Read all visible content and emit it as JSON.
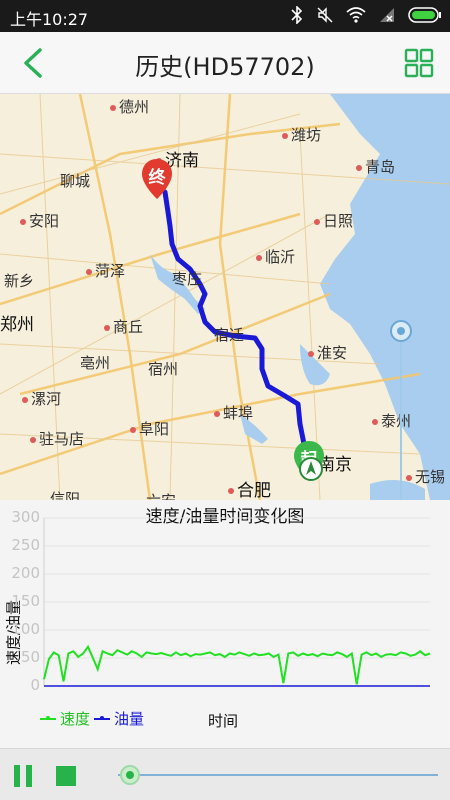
{
  "status_bar": {
    "time": "上午10:27"
  },
  "header": {
    "title": "历史(HD57702)"
  },
  "map": {
    "cities": [
      {
        "name": "德州",
        "big": false
      },
      {
        "name": "潍坊",
        "big": false
      },
      {
        "name": "济南",
        "big": true
      },
      {
        "name": "青岛",
        "big": false
      },
      {
        "name": "聊城",
        "big": false
      },
      {
        "name": "安阳",
        "big": false
      },
      {
        "name": "日照",
        "big": false
      },
      {
        "name": "新乡",
        "big": false
      },
      {
        "name": "菏泽",
        "big": false
      },
      {
        "name": "枣庄",
        "big": false
      },
      {
        "name": "临沂",
        "big": false
      },
      {
        "name": "郑州",
        "big": true
      },
      {
        "name": "商丘",
        "big": false
      },
      {
        "name": "宿迁",
        "big": false
      },
      {
        "name": "淮安",
        "big": false
      },
      {
        "name": "亳州",
        "big": false
      },
      {
        "name": "宿州",
        "big": false
      },
      {
        "name": "漯河",
        "big": false
      },
      {
        "name": "蚌埠",
        "big": false
      },
      {
        "name": "泰州",
        "big": false
      },
      {
        "name": "驻马店",
        "big": false
      },
      {
        "name": "阜阳",
        "big": false
      },
      {
        "name": "南京",
        "big": true
      },
      {
        "name": "合肥",
        "big": true
      },
      {
        "name": "无锡",
        "big": false
      },
      {
        "name": "信阳",
        "big": false
      },
      {
        "name": "六安",
        "big": false
      }
    ],
    "end_marker": "终",
    "start_marker": "起",
    "route_color": "#1a1ad6"
  },
  "chart_data": {
    "type": "line",
    "title": "速度/油量时间变化图",
    "ylabel": "速度/油量",
    "xlabel": "时间",
    "ylim": [
      0,
      300
    ],
    "yticks": [
      "300",
      "250",
      "200",
      "150",
      "100",
      "50",
      "0"
    ],
    "grid": true,
    "legend": "bottom-left",
    "series": [
      {
        "name": "速度",
        "color": "#22e022",
        "values": [
          12,
          48,
          60,
          55,
          8,
          58,
          62,
          52,
          58,
          70,
          50,
          30,
          62,
          58,
          55,
          64,
          60,
          56,
          62,
          58,
          52,
          60,
          58,
          57,
          59,
          56,
          54,
          60,
          55,
          58,
          53,
          57,
          56,
          58,
          60,
          55,
          57,
          52,
          58,
          56,
          60,
          57,
          54,
          58,
          55,
          56,
          58,
          52,
          56,
          5,
          58,
          60,
          54,
          58,
          55,
          57,
          53,
          58,
          56,
          55,
          60,
          57,
          52,
          58,
          3,
          56,
          60,
          55,
          58,
          52,
          56,
          57,
          55,
          60,
          58,
          54,
          56,
          62,
          55,
          58
        ]
      },
      {
        "name": "油量",
        "color": "#1a1ad6",
        "values": [
          0,
          0,
          0,
          0,
          0,
          0,
          0,
          0,
          0,
          0,
          0,
          0,
          0,
          0,
          0,
          0,
          0,
          0,
          0,
          0,
          0,
          0,
          0,
          0,
          0,
          0,
          0,
          0,
          0,
          0,
          0,
          0,
          0,
          0,
          0,
          0,
          0,
          0,
          0,
          0,
          0,
          0,
          0,
          0,
          0,
          0,
          0,
          0,
          0,
          0,
          0,
          0,
          0,
          0,
          0,
          0,
          0,
          0,
          0,
          0,
          0,
          0,
          0,
          0,
          0,
          0,
          0,
          0,
          0,
          0,
          0,
          0,
          0,
          0,
          0,
          0,
          0,
          0,
          0,
          0
        ]
      }
    ]
  },
  "colors": {
    "accent": "#27b24a"
  }
}
